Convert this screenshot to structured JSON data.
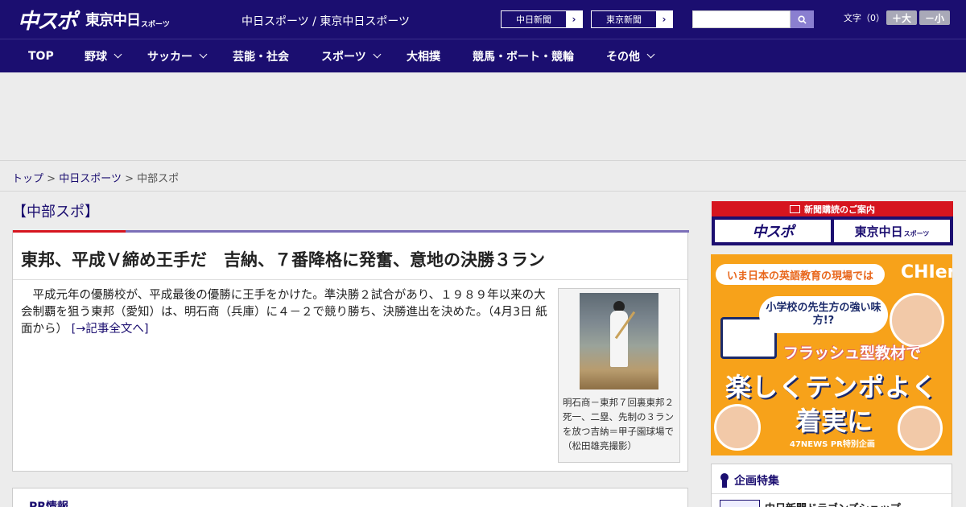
{
  "header": {
    "logo_main": "中スポ",
    "logo_sub": "東京中日",
    "logo_tiny": "スポーツ",
    "site_title": "中日スポーツ / 東京中日スポーツ",
    "paper_links": [
      {
        "label": "中日新聞",
        "chevron": "›"
      },
      {
        "label": "東京新聞",
        "chevron": "›"
      }
    ],
    "search": {
      "placeholder": "",
      "value": ""
    },
    "font_size": {
      "label": "文字（0）",
      "larger": "＋大",
      "smaller": "－小"
    }
  },
  "nav": {
    "items": [
      {
        "label": "TOP",
        "has_dropdown": false
      },
      {
        "label": "野球",
        "has_dropdown": true
      },
      {
        "label": "サッカー",
        "has_dropdown": true
      },
      {
        "label": "芸能・社会",
        "has_dropdown": false
      },
      {
        "label": "スポーツ",
        "has_dropdown": true
      },
      {
        "label": "大相撲",
        "has_dropdown": false
      },
      {
        "label": "競馬・ボート・競輪",
        "has_dropdown": false
      },
      {
        "label": "その他",
        "has_dropdown": true
      }
    ]
  },
  "breadcrumb": {
    "items": [
      "トップ",
      "中日スポーツ",
      "中部スポ"
    ],
    "separator": ">"
  },
  "main": {
    "section_label": "【中部スポ】",
    "article": {
      "headline": "東邦、平成Ｖ締め王手だ　吉納、７番降格に発奮、意地の決勝３ラン",
      "body": "平成元年の優勝校が、平成最後の優勝に王手をかけた。準決勝２試合があり、１９８９年以来の大会制覇を狙う東邦（愛知）は、明石商（兵庫）に４－２で競り勝ち、決勝進出を決めた。（4月3日 紙面から）",
      "read_more": "[→記事全文へ]",
      "photo_caption": "明石商－東邦７回裏東邦２死一、二塁、先制の３ランを放つ吉納＝甲子園球場で（松田雄亮撮影）"
    },
    "pr": {
      "title": "PR情報"
    }
  },
  "sidebar": {
    "subscription": {
      "heading": "新聞購読のご案内",
      "logo_a": "中スポ",
      "logo_b": "東京中日",
      "logo_b_small": "スポーツ"
    },
    "ad": {
      "ribbon": "いま日本の英語教育の現場では",
      "brand": "CHIeru",
      "bubble": "小学校の先生方の強い味方!?",
      "line3": "フラッシュ型教材で",
      "line4": "楽しくテンポよく",
      "line5": "着実に",
      "footer": "47NEWS PR特別企画"
    },
    "feature": {
      "title": "企画特集",
      "item": "中日新聞ドラゴンズショップ"
    }
  },
  "colors": {
    "brand_navy": "#1b0e70",
    "accent_red": "#d6151f",
    "accent_purple": "#7b6fb8",
    "ad_orange": "#f7a21a"
  }
}
